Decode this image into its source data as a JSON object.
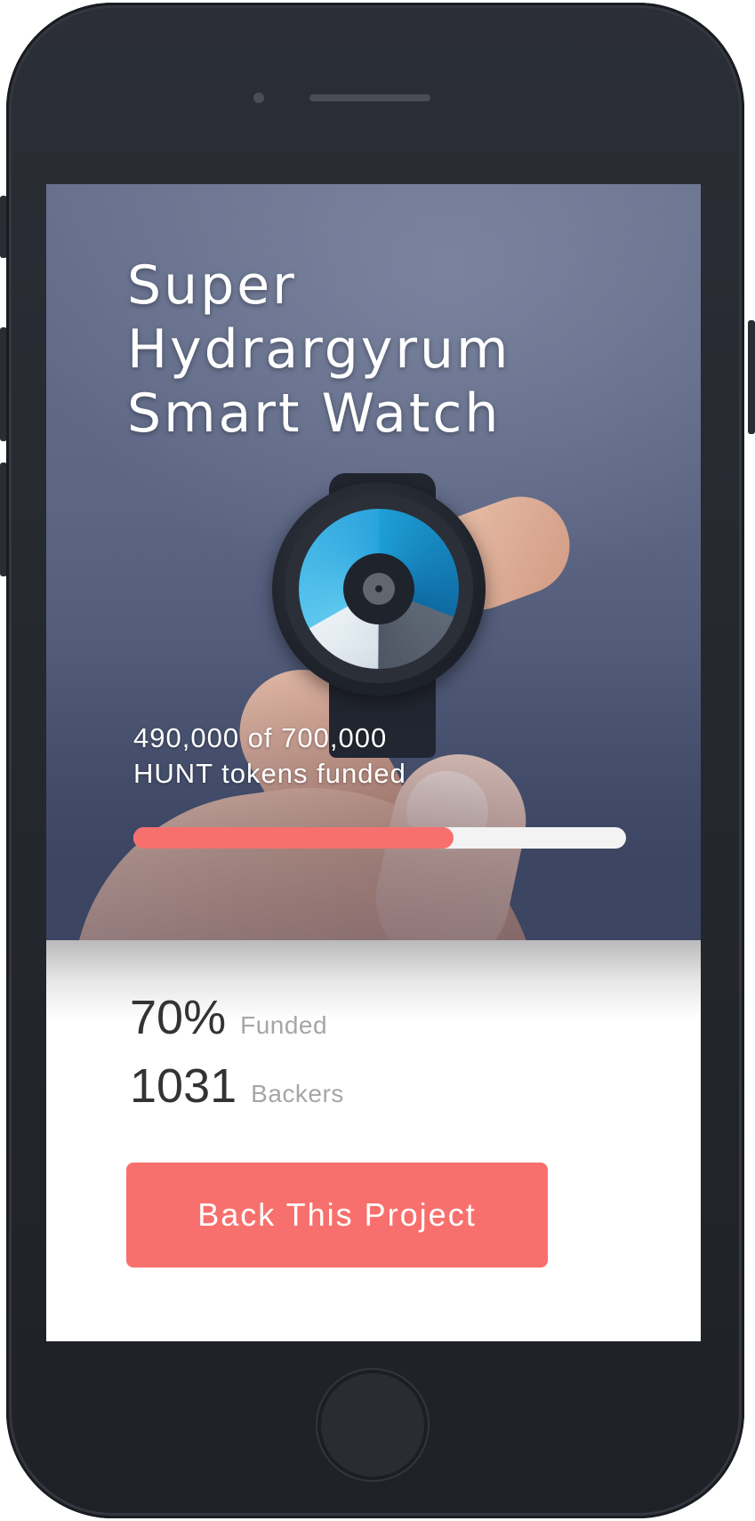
{
  "project": {
    "title_lines": [
      "Super",
      "Hydrargyrum",
      "Smart Watch"
    ]
  },
  "funding": {
    "line1": "490,000 of 700,000",
    "line2": "HUNT tokens funded",
    "progress_fraction": 0.65,
    "progress_color": "#f8706d"
  },
  "stats": {
    "percent_value": "70%",
    "percent_label": "Funded",
    "backers_value": "1031",
    "backers_label": "Backers"
  },
  "cta": {
    "label": "Back This Project",
    "color": "#f8706d"
  },
  "device": {
    "icons": [
      "camera-icon",
      "speaker-icon",
      "home-button"
    ]
  }
}
